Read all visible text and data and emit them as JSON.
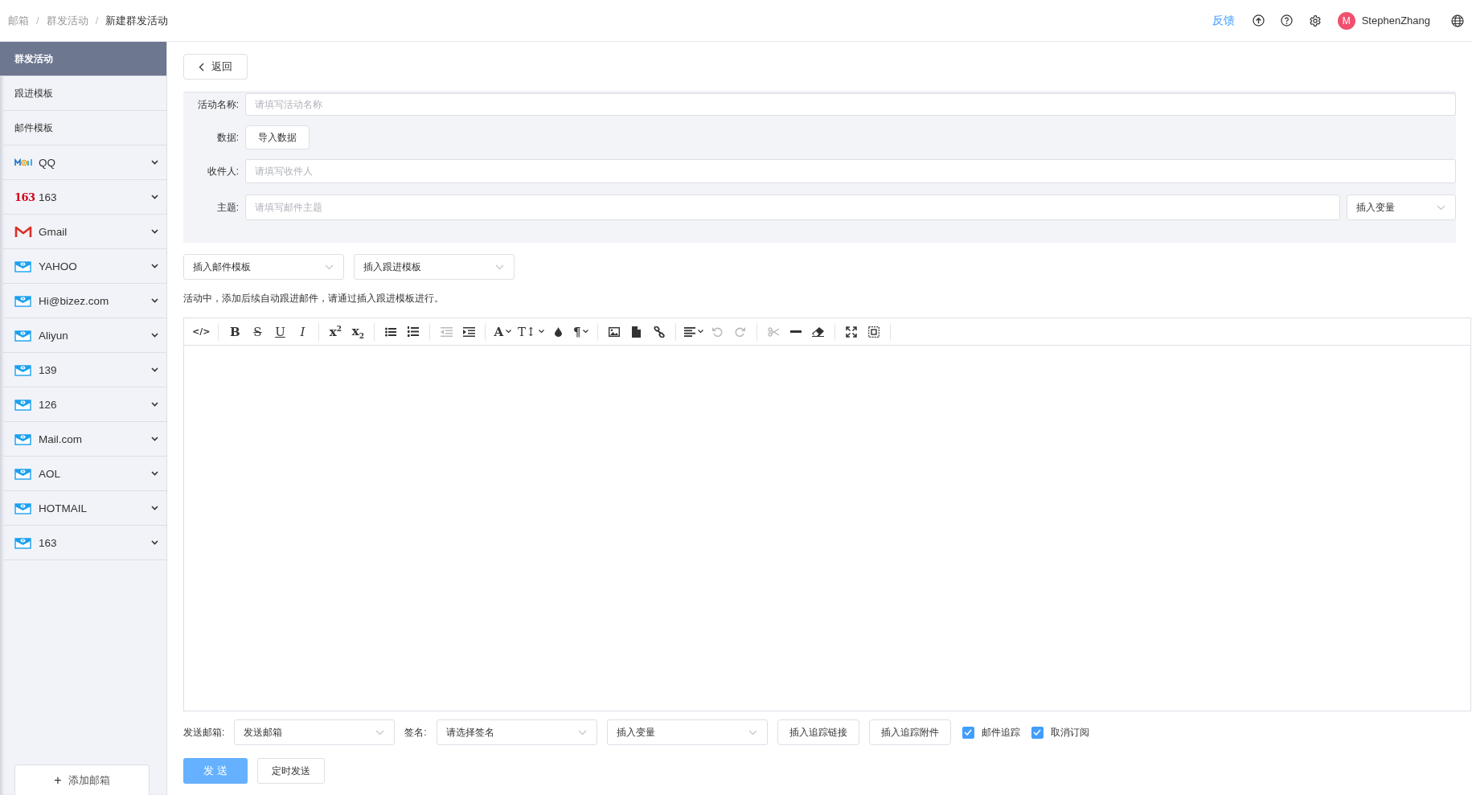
{
  "header": {
    "breadcrumb": [
      {
        "label": "邮箱",
        "current": false
      },
      {
        "label": "群发活动",
        "current": false
      },
      {
        "label": "新建群发活动",
        "current": true
      }
    ],
    "separator": "/",
    "feedback": "反馈",
    "user": {
      "initial": "M",
      "name": "StephenZhang"
    }
  },
  "sidebar": {
    "items": [
      {
        "label": "群发活动",
        "kind": "plain",
        "selected": true
      },
      {
        "label": "跟进模板",
        "kind": "plain",
        "selected": false
      },
      {
        "label": "邮件模板",
        "kind": "plain",
        "selected": false
      },
      {
        "label": "QQ",
        "kind": "qqmail",
        "selected": false
      },
      {
        "label": "163",
        "kind": "logo163",
        "logo_text": "163",
        "selected": false
      },
      {
        "label": "Gmail",
        "kind": "gmail",
        "selected": false
      },
      {
        "label": "YAHOO",
        "kind": "envelope",
        "selected": false
      },
      {
        "label": "Hi@bizez.com",
        "kind": "envelope",
        "selected": false
      },
      {
        "label": "Aliyun",
        "kind": "envelope",
        "selected": false
      },
      {
        "label": "139",
        "kind": "envelope",
        "selected": false
      },
      {
        "label": "126",
        "kind": "envelope",
        "selected": false
      },
      {
        "label": "Mail.com",
        "kind": "envelope",
        "selected": false
      },
      {
        "label": "AOL",
        "kind": "envelope",
        "selected": false
      },
      {
        "label": "HOTMAIL",
        "kind": "envelope",
        "selected": false
      },
      {
        "label": "163",
        "kind": "envelope",
        "selected": false
      }
    ],
    "add_button": "添加邮箱",
    "add_glyph": "+"
  },
  "back_button": "返回",
  "form": {
    "rows": [
      {
        "label": "活动名称:",
        "kind": "input",
        "placeholder": "请填写活动名称"
      },
      {
        "label": "数据:",
        "kind": "button",
        "button": "导入数据"
      },
      {
        "label": "收件人:",
        "kind": "input",
        "placeholder": "请填写收件人"
      },
      {
        "label": "主题:",
        "kind": "input_select",
        "placeholder": "请填写邮件主题",
        "select": "插入变量"
      }
    ]
  },
  "template_selects": [
    "插入邮件模板",
    "插入跟进模板"
  ],
  "note": "活动中，添加后续自动跟进邮件，请通过插入跟进模板进行。",
  "toolbar": [
    [
      {
        "kind": "glyph",
        "glyph": "</>",
        "disabled": false,
        "caret": false
      }
    ],
    [
      {
        "kind": "glyph",
        "glyph": "B",
        "disabled": false,
        "caret": false
      },
      {
        "kind": "glyph",
        "glyph": "S",
        "disabled": false,
        "caret": false
      },
      {
        "kind": "glyph",
        "glyph": "U",
        "disabled": false,
        "caret": false
      },
      {
        "kind": "glyph",
        "glyph": "I",
        "disabled": false,
        "caret": false
      }
    ],
    [
      {
        "kind": "glyph",
        "glyph": "x$^{2}$",
        "disabled": false,
        "caret": false
      },
      {
        "kind": "glyph",
        "glyph": "x$_{2}$",
        "disabled": false,
        "caret": false
      }
    ],
    [
      {
        "kind": "bullets",
        "disabled": false,
        "caret": false
      },
      {
        "kind": "numbers",
        "disabled": false,
        "caret": false
      }
    ],
    [
      {
        "kind": "outdent",
        "disabled": true,
        "caret": false
      },
      {
        "kind": "indent",
        "disabled": false,
        "caret": false
      }
    ],
    [
      {
        "kind": "glyph",
        "glyph": "A",
        "disabled": false,
        "caret": true
      },
      {
        "kind": "glyph",
        "glyph": "T↕",
        "disabled": false,
        "caret": true
      },
      {
        "kind": "drop",
        "disabled": false,
        "caret": false
      },
      {
        "kind": "glyph",
        "glyph": "¶",
        "disabled": false,
        "caret": true
      }
    ],
    [
      {
        "kind": "image",
        "disabled": false,
        "caret": false
      },
      {
        "kind": "file",
        "disabled": false,
        "caret": false
      },
      {
        "kind": "link",
        "disabled": false,
        "caret": false
      }
    ],
    [
      {
        "kind": "align",
        "disabled": false,
        "caret": true
      },
      {
        "kind": "undo",
        "disabled": true,
        "caret": false
      },
      {
        "kind": "redo",
        "disabled": true,
        "caret": false
      }
    ],
    [
      {
        "kind": "cut",
        "disabled": true,
        "caret": false
      },
      {
        "kind": "hr",
        "disabled": false,
        "caret": false
      },
      {
        "kind": "eraser",
        "disabled": false,
        "caret": false
      }
    ],
    [
      {
        "kind": "fullscreen",
        "disabled": false,
        "caret": false
      },
      {
        "kind": "select",
        "disabled": false,
        "caret": false
      }
    ]
  ],
  "footer": {
    "sender_label": "发送邮箱:",
    "sender_select": "发送邮箱",
    "signature_label": "签名:",
    "signature_select": "请选择签名",
    "variable_select": "插入变量",
    "buttons": [
      "插入追踪链接",
      "插入追踪附件"
    ],
    "checkboxes": [
      {
        "label": "邮件追踪",
        "checked": true
      },
      {
        "label": "取消订阅",
        "checked": true
      }
    ],
    "send": "发 送",
    "schedule": "定时发送"
  }
}
